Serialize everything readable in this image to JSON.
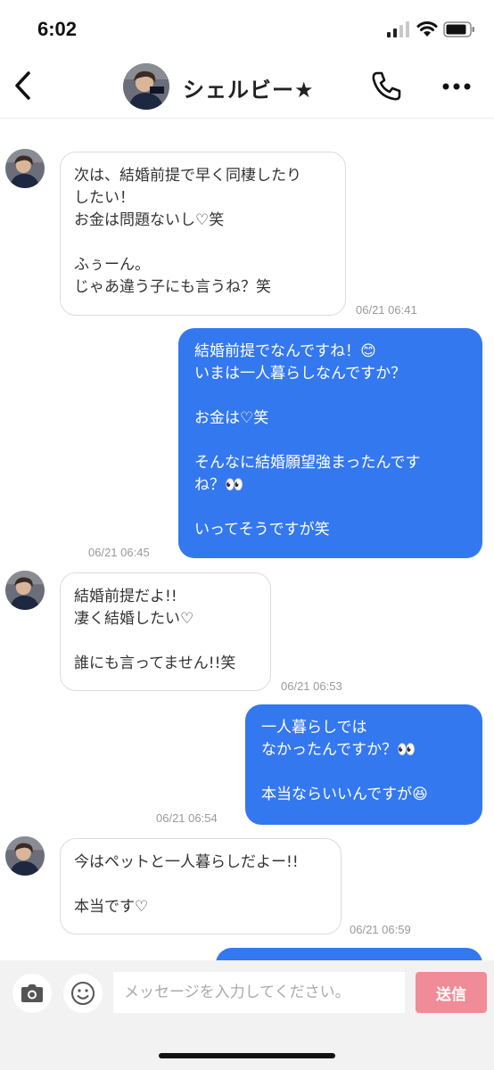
{
  "status_bar": {
    "time": "6:02"
  },
  "header": {
    "title": "シェルビー★"
  },
  "messages": [
    {
      "from": "them",
      "text": "次は、結婚前提で早く同棲したり\nしたい！\nお金は問題ないし♡笑\n\nふぅーん。\nじゃあ違う子にも言うね？笑",
      "time": "06/21 06:41"
    },
    {
      "from": "me",
      "text": "結婚前提でなんですね！😊\nいまは一人暮らしなんですか？\n\nお金は♡笑\n\nそんなに結婚願望強まったんです\nね？👀\n\nいってそうですが笑",
      "time": "06/21 06:45"
    },
    {
      "from": "them",
      "text": "結婚前提だよ!!\n凄く結婚したい♡\n\n誰にも言ってません!!笑",
      "time": "06/21 06:53"
    },
    {
      "from": "me",
      "text": "一人暮らしでは\nなかったんですか？👀\n\n本当ならいいんですが😆",
      "time": "06/21 06:54"
    },
    {
      "from": "them",
      "text": "今はペットと一人暮らしだよー!!\n\n本当です♡",
      "time": "06/21 06:59"
    }
  ],
  "input": {
    "placeholder": "メッセージを入力してください。",
    "value": ""
  },
  "send_label": "送信",
  "icons": {
    "back": "chevron-left-icon",
    "call": "phone-icon",
    "more": "more-horizontal-icon",
    "camera": "camera-icon",
    "emoji": "smiley-icon"
  },
  "colors": {
    "outgoing_bubble": "#3478f0",
    "send_button": "#f08c97",
    "input_bar": "#f2f2f2"
  }
}
